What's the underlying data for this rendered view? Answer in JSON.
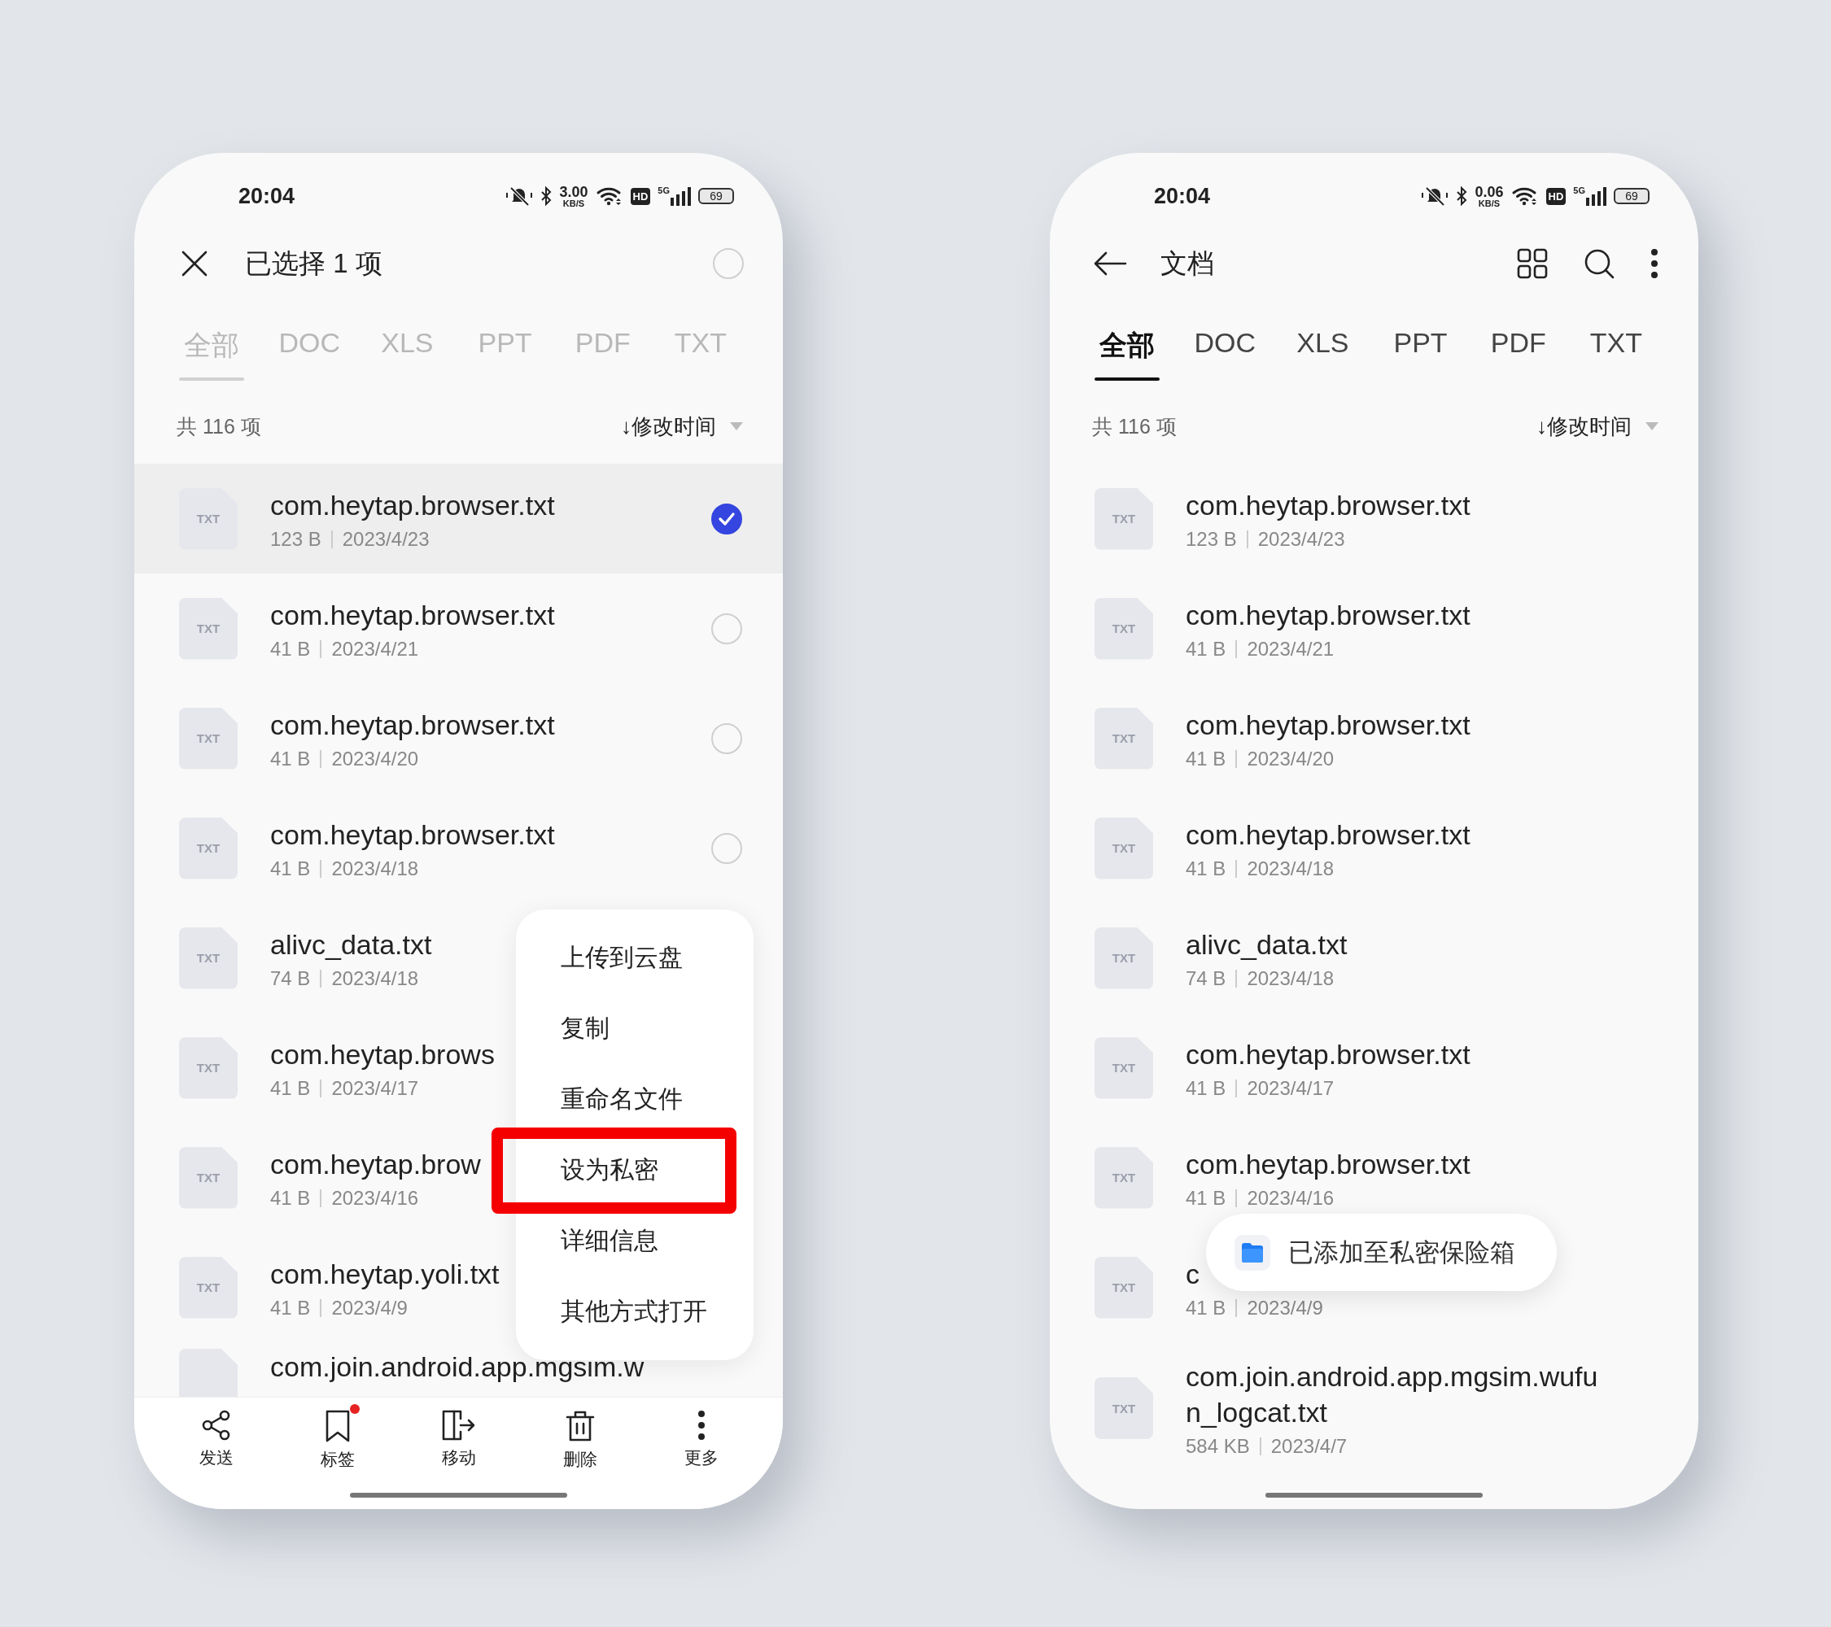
{
  "screens": [
    {
      "status_bar": {
        "time": "20:04",
        "speed": "3.00",
        "speed_unit": "KB/S",
        "hd": "HD",
        "network": "5G",
        "battery": "69"
      },
      "header": {
        "kind": "selection",
        "title": "已选择 1 项",
        "select_all_checked": false
      },
      "tabs": {
        "disabled": true,
        "items": [
          {
            "label": "全部",
            "selected": true
          },
          {
            "label": "DOC",
            "selected": false
          },
          {
            "label": "XLS",
            "selected": false
          },
          {
            "label": "PPT",
            "selected": false
          },
          {
            "label": "PDF",
            "selected": false
          },
          {
            "label": "TXT",
            "selected": false
          }
        ]
      },
      "count": "共 116 项",
      "sort": "↓修改时间",
      "files": [
        {
          "icon_label": "TXT",
          "name": "com.heytap.browser.txt",
          "size": "123 B",
          "date": "2023/4/23",
          "checked": true
        },
        {
          "icon_label": "TXT",
          "name": "com.heytap.browser.txt",
          "size": "41 B",
          "date": "2023/4/21",
          "checked": false
        },
        {
          "icon_label": "TXT",
          "name": "com.heytap.browser.txt",
          "size": "41 B",
          "date": "2023/4/20",
          "checked": false
        },
        {
          "icon_label": "TXT",
          "name": "com.heytap.browser.txt",
          "size": "41 B",
          "date": "2023/4/18",
          "checked": false
        },
        {
          "icon_label": "TXT",
          "name": "alivc_data.txt",
          "size": "74 B",
          "date": "2023/4/18"
        },
        {
          "icon_label": "TXT",
          "name": "com.heytap.brows",
          "size": "41 B",
          "date": "2023/4/17"
        },
        {
          "icon_label": "TXT",
          "name": "com.heytap.brow",
          "size": "41 B",
          "date": "2023/4/16"
        },
        {
          "icon_label": "TXT",
          "name": "com.heytap.yoli.txt",
          "size": "41 B",
          "date": "2023/4/9"
        },
        {
          "name": "com.join.android.app.mgsim.w"
        }
      ],
      "menu": {
        "items": [
          {
            "label": "上传到云盘",
            "highlighted": false
          },
          {
            "label": "复制",
            "highlighted": false
          },
          {
            "label": "重命名文件",
            "highlighted": false
          },
          {
            "label": "设为私密",
            "highlighted": true
          },
          {
            "label": "详细信息",
            "highlighted": false
          },
          {
            "label": "其他方式打开",
            "highlighted": false
          }
        ]
      },
      "toolbar": [
        {
          "kind": "share",
          "label": "发送",
          "badge": false
        },
        {
          "kind": "bookmark",
          "label": "标签",
          "badge": true
        },
        {
          "kind": "move",
          "label": "移动",
          "badge": false
        },
        {
          "kind": "delete",
          "label": "删除",
          "badge": false
        },
        {
          "kind": "more",
          "label": "更多",
          "badge": false
        }
      ]
    },
    {
      "status_bar": {
        "time": "20:04",
        "speed": "0.06",
        "speed_unit": "KB/S",
        "hd": "HD",
        "network": "5G",
        "battery": "69"
      },
      "header": {
        "kind": "browse",
        "title": "文档"
      },
      "tabs": {
        "disabled": false,
        "items": [
          {
            "label": "全部",
            "selected": true
          },
          {
            "label": "DOC",
            "selected": false
          },
          {
            "label": "XLS",
            "selected": false
          },
          {
            "label": "PPT",
            "selected": false
          },
          {
            "label": "PDF",
            "selected": false
          },
          {
            "label": "TXT",
            "selected": false
          }
        ]
      },
      "count": "共 116 项",
      "sort": "↓修改时间",
      "files": [
        {
          "icon_label": "TXT",
          "name": "com.heytap.browser.txt",
          "size": "123 B",
          "date": "2023/4/23"
        },
        {
          "icon_label": "TXT",
          "name": "com.heytap.browser.txt",
          "size": "41 B",
          "date": "2023/4/21"
        },
        {
          "icon_label": "TXT",
          "name": "com.heytap.browser.txt",
          "size": "41 B",
          "date": "2023/4/20"
        },
        {
          "icon_label": "TXT",
          "name": "com.heytap.browser.txt",
          "size": "41 B",
          "date": "2023/4/18"
        },
        {
          "icon_label": "TXT",
          "name": "alivc_data.txt",
          "size": "74 B",
          "date": "2023/4/18"
        },
        {
          "icon_label": "TXT",
          "name": "com.heytap.browser.txt",
          "size": "41 B",
          "date": "2023/4/17"
        },
        {
          "icon_label": "TXT",
          "name": "com.heytap.browser.txt",
          "size": "41 B",
          "date": "2023/4/16"
        },
        {
          "icon_label": "TXT",
          "name": "c",
          "size": "41 B",
          "date": "2023/4/9"
        },
        {
          "icon_label": "TXT",
          "name": "com.join.android.app.mgsim.wufun_logcat.txt",
          "size": "584 KB",
          "date": "2023/4/7"
        }
      ],
      "toast": {
        "text": "已添加至私密保险箱"
      }
    }
  ]
}
